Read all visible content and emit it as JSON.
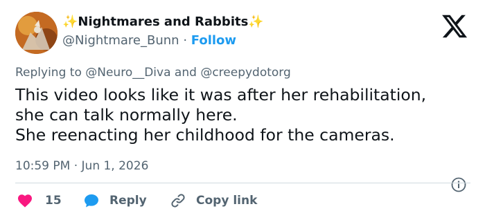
{
  "author": {
    "name_prefix": "✨",
    "name": "Nightmares and Rabbits",
    "name_suffix": "✨",
    "handle": "@Nightmare_Bunn",
    "separator": "·",
    "follow_label": "Follow"
  },
  "reply_context": {
    "prefix": "Replying to",
    "mention1": "@Neuro__Diva",
    "conjunction": "and",
    "mention2": "@creepydotorg"
  },
  "tweet": {
    "lines": [
      "This video looks like it was after her rehabilitation,",
      "she can talk normally here.",
      "She reenacting her childhood for the cameras."
    ],
    "timestamp": "10:59 PM · Jun 1, 2026"
  },
  "actions": {
    "like_count": "15",
    "reply_label": "Reply",
    "copy_link_label": "Copy link"
  },
  "colors": {
    "accent": "#1d9bf0",
    "like": "#f91880",
    "secondary_text": "#536471",
    "divider": "#cfd9de",
    "sparkle": "#f7b500"
  },
  "icons": {
    "logo": "x-logo-icon",
    "info": "info-icon",
    "like": "heart-icon",
    "reply": "speech-bubble-icon",
    "copy": "link-icon"
  }
}
